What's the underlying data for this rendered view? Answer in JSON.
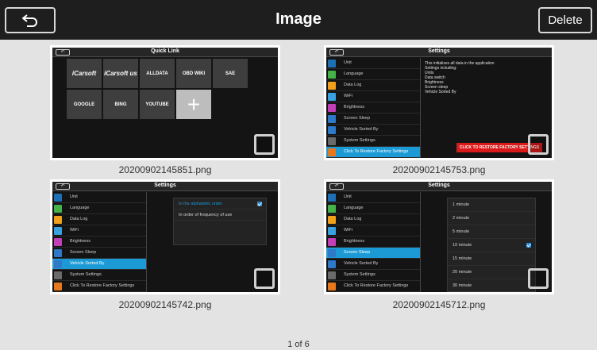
{
  "header": {
    "title": "Image",
    "delete_label": "Delete",
    "back_icon": "back-arrow-icon"
  },
  "pager": {
    "text": "1 of 6"
  },
  "images": [
    {
      "filename": "20200902145851.png",
      "screen_title": "Quick Link",
      "tiles": [
        "iCarsoft",
        "iCarsoft us",
        "ALLDATA",
        "OBD WIKI",
        "SAE",
        "GOOGLE",
        "BING",
        "YOUTUBE",
        "+"
      ]
    },
    {
      "filename": "20200902145753.png",
      "screen_title": "Settings",
      "menu": [
        "Unit",
        "Language",
        "Data Log",
        "WiFi",
        "Brightness",
        "Screen Sleep",
        "Vehicle Sorted By",
        "System Settings",
        "Click To Restore Factory Settings"
      ],
      "selected": 8,
      "info_lines": [
        "This initializes all data in the application",
        "Settings including:",
        "Units",
        "Data switch",
        "Brightness",
        "Screen sleep",
        "Vehicle Sorted By"
      ],
      "restore_button": "CLICK TO RESTORE FACTORY SETTINGS"
    },
    {
      "filename": "20200902145742.png",
      "screen_title": "Settings",
      "menu": [
        "Unit",
        "Language",
        "Data Log",
        "WiFi",
        "Brightness",
        "Screen Sleep",
        "Vehicle Sorted By",
        "System Settings",
        "Click To Restore Factory Settings"
      ],
      "selected": 6,
      "options": [
        "In the alphabetic order",
        "In order of frequency of use"
      ],
      "checked_option": 0
    },
    {
      "filename": "20200902145712.png",
      "screen_title": "Settings",
      "menu": [
        "Unit",
        "Language",
        "Data Log",
        "WiFi",
        "Brightness",
        "Screen Sleep",
        "Vehicle Sorted By",
        "System Settings",
        "Click To Restore Factory Settings"
      ],
      "selected": 5,
      "options": [
        "1   minute",
        "2   minute",
        "5   minute",
        "10   minute",
        "15   minute",
        "20   minute",
        "30   minute"
      ],
      "checked_option": 3
    }
  ],
  "menu_icon_colors": [
    "#1f6fb5",
    "#45b24a",
    "#f0a01a",
    "#3aa0e0",
    "#c23fb5",
    "#2f79c9",
    "#2f79c9",
    "#6a6a6a",
    "#e8781e"
  ],
  "colors": {
    "accent": "#1c9ad6",
    "danger": "#d91a1a",
    "topbar": "#1e1e1e",
    "background": "#e3e3e3"
  }
}
